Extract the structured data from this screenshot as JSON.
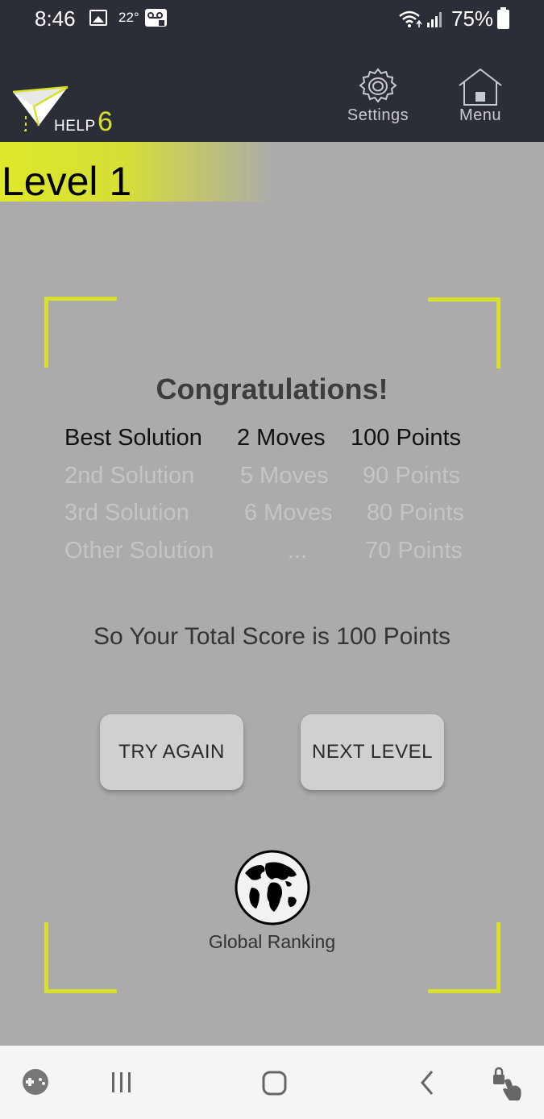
{
  "status_bar": {
    "time": "8:46",
    "temperature": "22°",
    "battery_percent": "75%"
  },
  "app": {
    "logo_help": "HELP",
    "help_count": "6",
    "settings_label": "Settings",
    "menu_label": "Menu",
    "accent_color": "#d8e02b",
    "header_bg": "#2c2e37"
  },
  "level": {
    "title": "Level 1"
  },
  "result": {
    "heading": "Congratulations!",
    "rows": [
      {
        "name": "Best Solution",
        "moves": "2 Moves",
        "points": "100 Points",
        "highlighted": true
      },
      {
        "name": "2nd Solution",
        "moves": "5 Moves",
        "points": "90 Points",
        "highlighted": false
      },
      {
        "name": "3rd Solution",
        "moves": "6 Moves",
        "points": "80 Points",
        "highlighted": false
      },
      {
        "name": "Other Solution",
        "moves": "...",
        "points": "70 Points",
        "highlighted": false
      }
    ],
    "total": "So Your Total Score is 100 Points"
  },
  "actions": {
    "try_again": "TRY AGAIN",
    "next_level": "NEXT LEVEL",
    "global_ranking": "Global Ranking"
  },
  "icons": {
    "image": "image-icon",
    "voicemail": "voicemail-icon",
    "wifi": "wifi-icon",
    "signal": "signal-icon",
    "battery": "battery-icon",
    "settings": "gear-icon",
    "menu": "home-icon",
    "globe": "globe-icon",
    "game_launcher": "gamepad-icon",
    "recents": "recents-icon",
    "home": "home-button-icon",
    "back": "back-icon",
    "touch_lock": "touch-lock-icon"
  }
}
